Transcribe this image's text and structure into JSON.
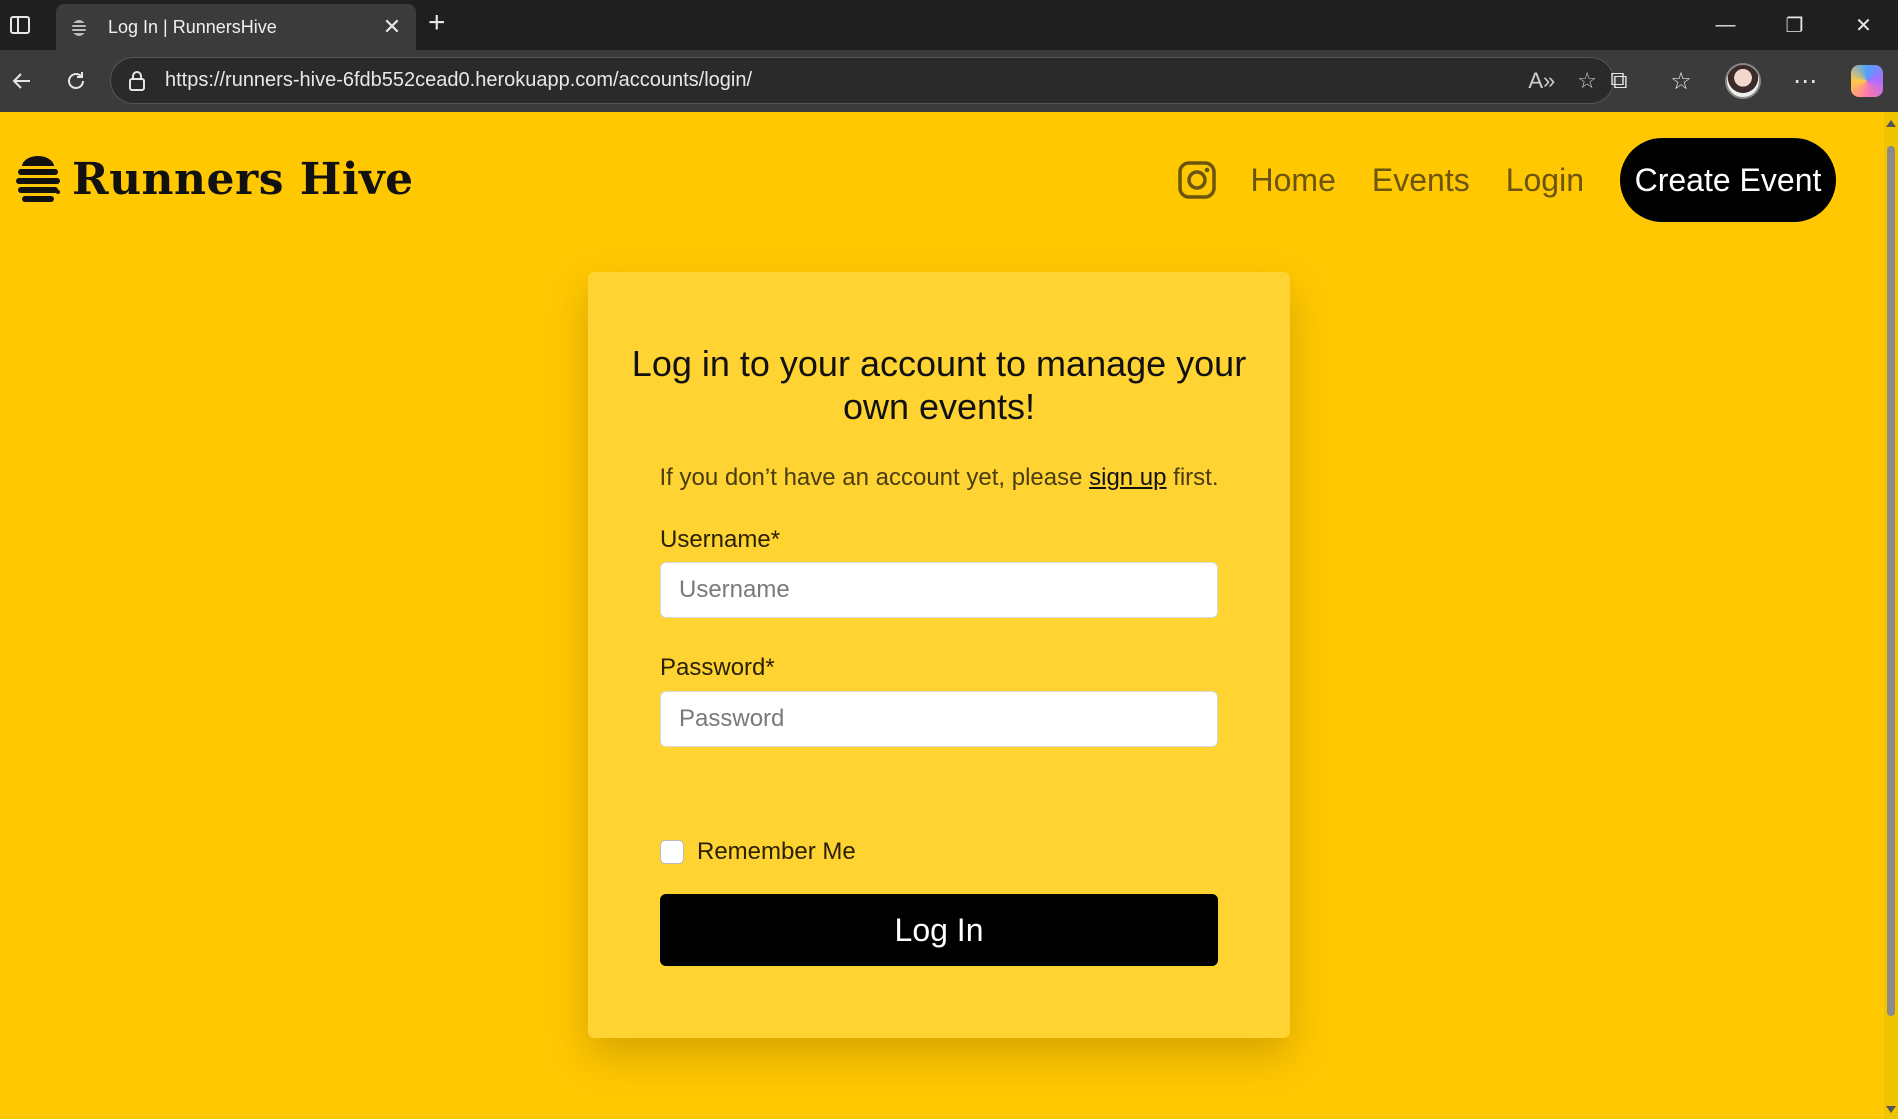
{
  "browser": {
    "tab_title": "Log In | RunnersHive",
    "tab_close": "✕",
    "new_tab": "+",
    "url": "https://runners-hive-6fdb552cead0.herokuapp.com/accounts/login/",
    "window_controls": {
      "minimize": "—",
      "restore": "❐",
      "close": "✕"
    }
  },
  "navbar": {
    "brand": "Runners Hive",
    "links": [
      "Home",
      "Events",
      "Login"
    ],
    "cta": "Create Event"
  },
  "login_card": {
    "heading": "Log in to your account to manage your own events!",
    "sub_text_before": "If you don’t have an account yet, please",
    "sub_link": "sign up",
    "sub_text_after": "first.",
    "username_label": "Username*",
    "username_placeholder": "Username",
    "username_value": "",
    "password_label": "Password*",
    "password_placeholder": "Password",
    "password_value": "",
    "remember_label": "Remember Me",
    "remember_checked": false,
    "submit_label": "Log In"
  },
  "colors": {
    "page_bg": "#ffc800",
    "card_bg": "#ffd332",
    "button_bg": "#000000",
    "nav_link": "#6b5510"
  }
}
